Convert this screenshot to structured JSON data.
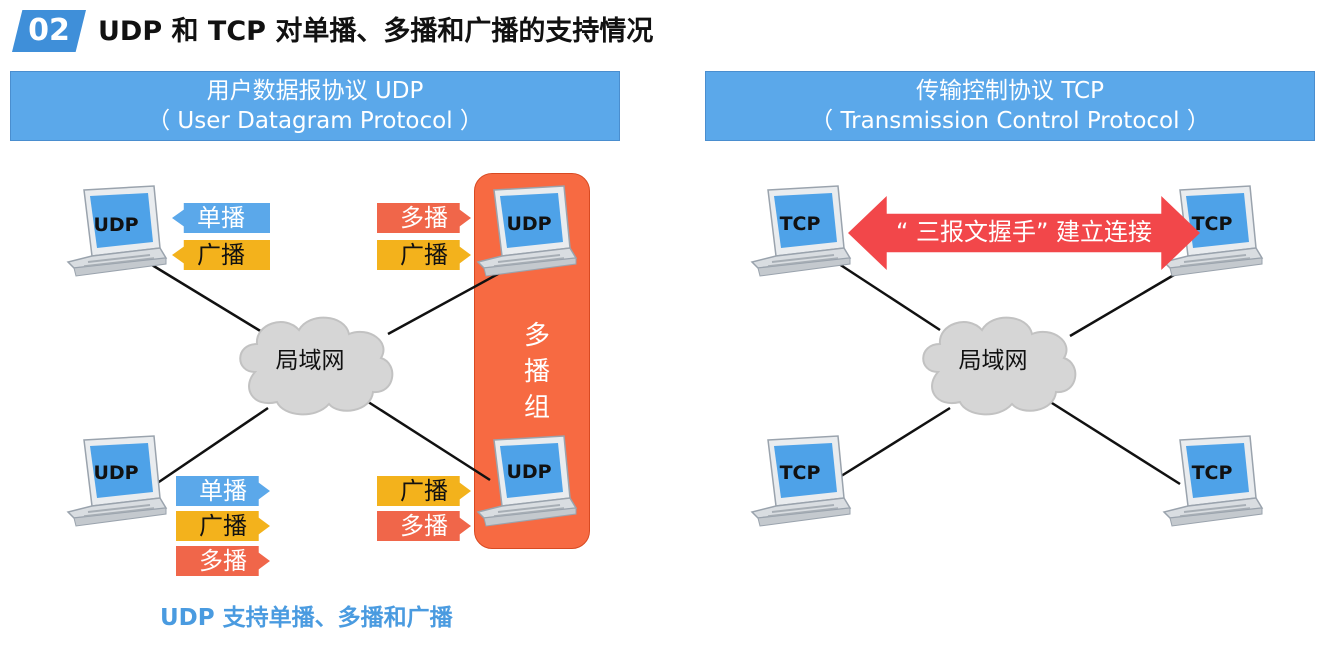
{
  "header": {
    "number": "02",
    "title": "UDP 和 TCP 对单播、多播和广播的支持情况"
  },
  "udp_panel": {
    "title_line1": "用户数据报协议 UDP",
    "title_line2": "（ User Datagram Protocol ）",
    "network_label": "局域网",
    "multicast_group_label": "多播组",
    "caption": "UDP 支持单播、多播和广播",
    "hosts": [
      {
        "label": "UDP",
        "tags": [
          {
            "text": "单播",
            "kind": "unicast",
            "direction": "in"
          },
          {
            "text": "广播",
            "kind": "broadcast",
            "direction": "in"
          }
        ]
      },
      {
        "label": "UDP",
        "tags": [
          {
            "text": "多播",
            "kind": "multicast",
            "direction": "out"
          },
          {
            "text": "广播",
            "kind": "broadcast",
            "direction": "out"
          }
        ]
      },
      {
        "label": "UDP",
        "tags": [
          {
            "text": "单播",
            "kind": "unicast",
            "direction": "out"
          },
          {
            "text": "广播",
            "kind": "broadcast",
            "direction": "out"
          },
          {
            "text": "多播",
            "kind": "multicast",
            "direction": "out"
          }
        ]
      },
      {
        "label": "UDP",
        "tags": [
          {
            "text": "广播",
            "kind": "broadcast",
            "direction": "out"
          },
          {
            "text": "多播",
            "kind": "multicast",
            "direction": "out"
          }
        ]
      }
    ]
  },
  "tcp_panel": {
    "title_line1": "传输控制协议 TCP",
    "title_line2": "（ Transmission Control Protocol ）",
    "network_label": "局域网",
    "handshake_label": "“ 三报文握手” 建立连接",
    "hosts": [
      "TCP",
      "TCP",
      "TCP",
      "TCP"
    ]
  },
  "colors": {
    "panel_header": "#5ba8ea",
    "unicast": "#5ba8ea",
    "multicast": "#f0664a",
    "broadcast": "#f3b21c",
    "multicast_group": "#f76a42",
    "handshake_arrow": "#f2474a",
    "caption": "#4a9be0"
  }
}
